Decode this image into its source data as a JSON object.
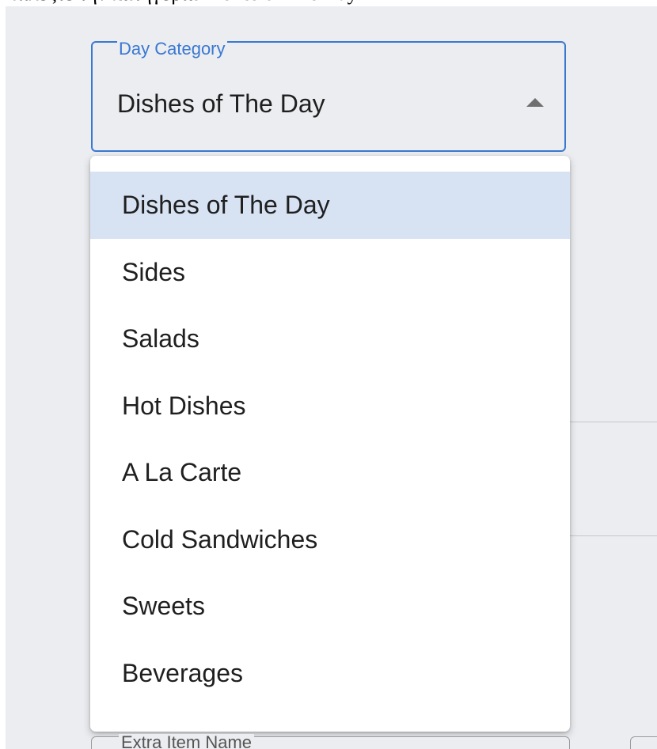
{
  "instruction": "Επιλέξτε την κατηγορία Dishes of The Day",
  "day_category": {
    "label": "Day Category",
    "selected_value": "Dishes of The Day",
    "icon": "caret-up-icon",
    "options": [
      "Dishes of The Day",
      "Sides",
      "Salads",
      "Hot Dishes",
      "A La Carte",
      "Cold Sandwiches",
      "Sweets",
      "Beverages"
    ],
    "highlighted_option": "Dishes of The Day"
  },
  "extra_item": {
    "label": "Extra Item Name"
  },
  "colors": {
    "accent": "#3a78d2",
    "highlight": "#d7e2f3",
    "background": "#ebedf0"
  }
}
